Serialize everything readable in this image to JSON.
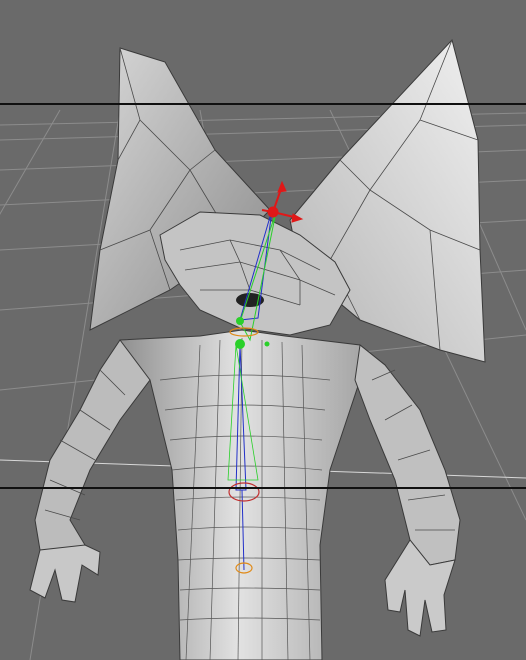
{
  "viewport": {
    "label": "",
    "background": "#6a6a6a",
    "grid_color": "#8a8a8a",
    "mesh_fill": "#d4d4d4",
    "mesh_wire": "#3a3a3a",
    "bone_blue": "#2230c8",
    "bone_green": "#2ad02a",
    "gizmo_red": "#e01818",
    "gizmo_orange": "#e08a18",
    "safe_frame_color": "#101010"
  },
  "scene": {
    "object": "3d-character-mesh",
    "view": "perspective",
    "gizmo": "move-gizmo"
  }
}
